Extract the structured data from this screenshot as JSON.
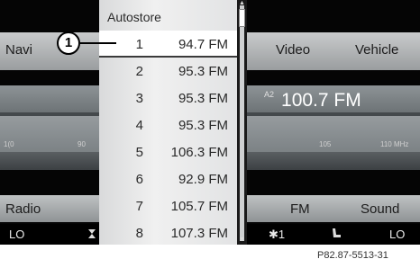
{
  "top_menu": {
    "navi": "Navi",
    "video": "Video",
    "vehicle": "Vehicle"
  },
  "station_display": {
    "prefix": "A2",
    "frequency": "100.7 FM"
  },
  "scale": {
    "left_a": "1(0",
    "left_b": "90",
    "right_a": "105",
    "right_b": "110 MHz"
  },
  "bottom_menu": {
    "radio": "Radio",
    "fm": "FM",
    "sound": "Sound"
  },
  "status": {
    "left_lo": "LO",
    "left_icon": "fan-icon",
    "right_indicator": "✱1",
    "right_icon": "seat-icon",
    "right_lo": "LO"
  },
  "list": {
    "title": "Autostore",
    "rows": [
      {
        "num": "1",
        "freq": "94.7 FM"
      },
      {
        "num": "2",
        "freq": "95.3 FM"
      },
      {
        "num": "3",
        "freq": "95.3 FM"
      },
      {
        "num": "4",
        "freq": "95.3 FM"
      },
      {
        "num": "5",
        "freq": "106.3 FM"
      },
      {
        "num": "6",
        "freq": "92.9 FM"
      },
      {
        "num": "7",
        "freq": "105.7 FM"
      },
      {
        "num": "8",
        "freq": "107.3 FM"
      }
    ]
  },
  "callout": "1",
  "reference": "P82.87-5513-31"
}
